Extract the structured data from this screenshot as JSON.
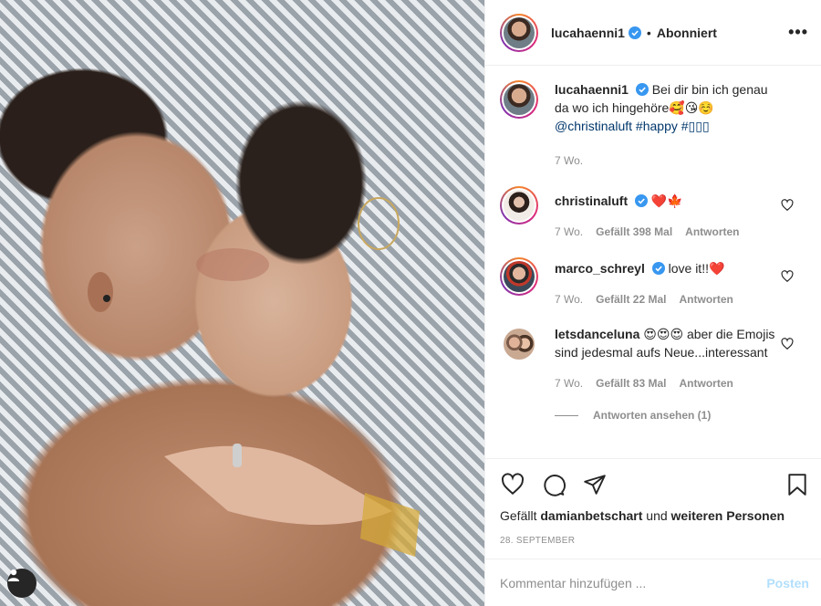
{
  "colors": {
    "accent": "#0095f6",
    "link": "#00376b",
    "muted": "#8e8e8e",
    "verified": "#3897f0",
    "post_disabled": "#b2dffc"
  },
  "header": {
    "username": "lucahaenni1",
    "dot": "•",
    "follow_status": "Abonniert",
    "more_icon": "more-horizontal-icon",
    "more_label": "•••"
  },
  "caption": {
    "username": "lucahaenni1",
    "text": "Bei dir bin ich genau da wo ich hingehöre🥰😘☺️",
    "mention": "@christinaluft",
    "hashtag1": "#happy",
    "hashtag2": "#▯▯▯",
    "time": "7 Wo."
  },
  "comments": [
    {
      "username": "christinaluft",
      "text": "❤️🍁",
      "time": "7 Wo.",
      "likes": "Gefällt 398 Mal",
      "reply": "Antworten"
    },
    {
      "username": "marco_schreyl",
      "text": "love it!!❤️",
      "time": "7 Wo.",
      "likes": "Gefällt 22 Mal",
      "reply": "Antworten"
    },
    {
      "username": "letsdanceluna",
      "text": "😍😍😍 aber die Emojis sind jedesmal aufs Neue...interessant",
      "time": "7 Wo.",
      "likes": "Gefällt 83 Mal",
      "reply": "Antworten"
    }
  ],
  "view_replies": "Antworten ansehen (1)",
  "likes_line": {
    "prefix": "Gefällt",
    "user": "damianbetschart",
    "middle": "und",
    "rest": "weiteren Personen"
  },
  "date": "28. SEPTEMBER",
  "add_comment": {
    "placeholder": "Kommentar hinzufügen ...",
    "post_label": "Posten"
  },
  "icons": [
    "heart-icon",
    "comment-icon",
    "share-icon",
    "bookmark-icon",
    "user-icon",
    "verified-icon"
  ]
}
